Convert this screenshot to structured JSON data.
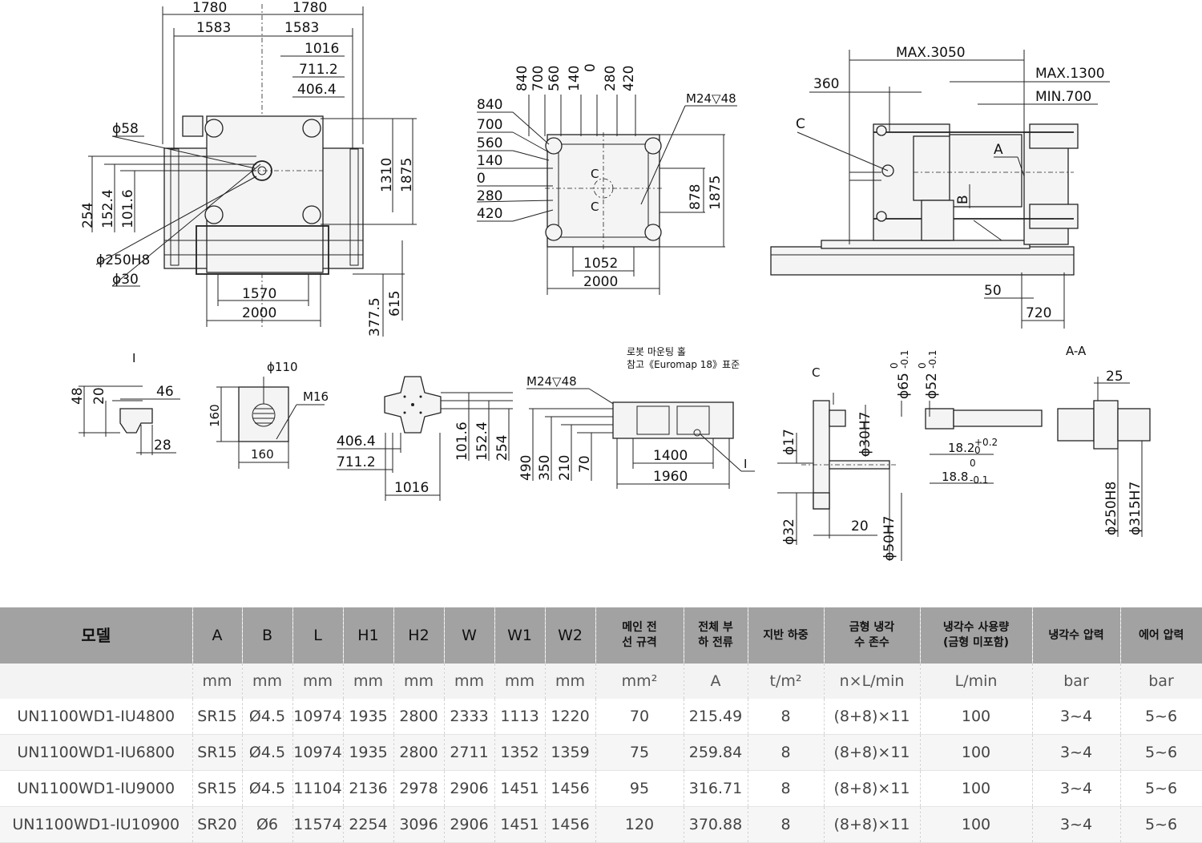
{
  "drawing": {
    "front_view": {
      "dims_top": [
        "1780",
        "1780",
        "1583",
        "1583",
        "1016",
        "711.2",
        "406.4"
      ],
      "dims_right": [
        "1310",
        "1875"
      ],
      "dims_left": [
        "254",
        "152.4",
        "101.6"
      ],
      "callouts": [
        "ϕ58",
        "ϕ250H8",
        "ϕ30"
      ],
      "dims_bottom": [
        "1570",
        "2000"
      ],
      "dims_bottom_right": [
        "377.5",
        "615"
      ]
    },
    "platen_view": {
      "dims_top": [
        "840",
        "700",
        "560",
        "140",
        "0",
        "280",
        "420"
      ],
      "dims_left": [
        "840",
        "700",
        "560",
        "140",
        "0",
        "280",
        "420"
      ],
      "thread": "M24▽48",
      "section": "C",
      "dims_right": [
        "878",
        "1875"
      ],
      "dims_bottom": [
        "1052",
        "2000"
      ]
    },
    "side_view": {
      "dims_top": [
        "MAX.3050",
        "MAX.1300",
        "MIN.700",
        "360"
      ],
      "labels": [
        "C",
        "A",
        "B"
      ],
      "dims_bottom": [
        "50",
        "720"
      ]
    },
    "detail_I": {
      "title": "I",
      "dims": [
        "48",
        "20",
        "46",
        "28"
      ]
    },
    "hole_detail": {
      "dims": [
        "ϕ110",
        "M16",
        "160",
        "160"
      ]
    },
    "platen_holes": {
      "dims": [
        "406.4",
        "711.2",
        "1016",
        "101.6",
        "152.4",
        "254"
      ]
    },
    "robot_mount": {
      "note_line1": "로봇 마운팅 홀",
      "note_line2": "참고《Euromap 18》표준",
      "thread": "M24▽48",
      "dims": [
        "490",
        "350",
        "210",
        "70",
        "1400",
        "1960"
      ],
      "ref": "I"
    },
    "detail_C": {
      "title": "C",
      "dims": [
        "ϕ65",
        "ϕ52",
        "ϕ30H7",
        "18.2",
        "18.8",
        "ϕ17",
        "ϕ32",
        "20",
        "ϕ50H7"
      ],
      "tolerances": [
        "0",
        "-0.1",
        "0",
        "-0.1",
        "+0.2",
        "0",
        "0",
        "-0.1"
      ]
    },
    "section_AA": {
      "title": "A-A",
      "dims": [
        "25",
        "ϕ250H8",
        "ϕ315H7"
      ]
    }
  },
  "table": {
    "headers": [
      "모델",
      "A",
      "B",
      "L",
      "H1",
      "H2",
      "W",
      "W1",
      "W2",
      "메인 전\n선 규격",
      "전체 부\n하 전류",
      "지반 하중",
      "금형 냉각\n수 존수",
      "냉각수 사용량\n(금형 미포함)",
      "냉각수 압력",
      "에어 압력"
    ],
    "units": [
      "",
      "mm",
      "mm",
      "mm",
      "mm",
      "mm",
      "mm",
      "mm",
      "mm",
      "mm²",
      "A",
      "t/m²",
      "n×L/min",
      "L/min",
      "bar",
      "bar"
    ],
    "rows": [
      [
        "UN1100WD1-IU4800",
        "SR15",
        "Ø4.5",
        "10974",
        "1935",
        "2800",
        "2333",
        "1113",
        "1220",
        "70",
        "215.49",
        "8",
        "(8+8)×11",
        "100",
        "3~4",
        "5~6"
      ],
      [
        "UN1100WD1-IU6800",
        "SR15",
        "Ø4.5",
        "10974",
        "1935",
        "2800",
        "2711",
        "1352",
        "1359",
        "75",
        "259.84",
        "8",
        "(8+8)×11",
        "100",
        "3~4",
        "5~6"
      ],
      [
        "UN1100WD1-IU9000",
        "SR15",
        "Ø4.5",
        "11104",
        "2136",
        "2978",
        "2906",
        "1451",
        "1456",
        "95",
        "316.71",
        "8",
        "(8+8)×11",
        "100",
        "3~4",
        "5~6"
      ],
      [
        "UN1100WD1-IU10900",
        "SR20",
        "Ø6",
        "11574",
        "2254",
        "3096",
        "2906",
        "1451",
        "1456",
        "120",
        "370.88",
        "8",
        "(8+8)×11",
        "100",
        "3~4",
        "5~6"
      ]
    ]
  }
}
